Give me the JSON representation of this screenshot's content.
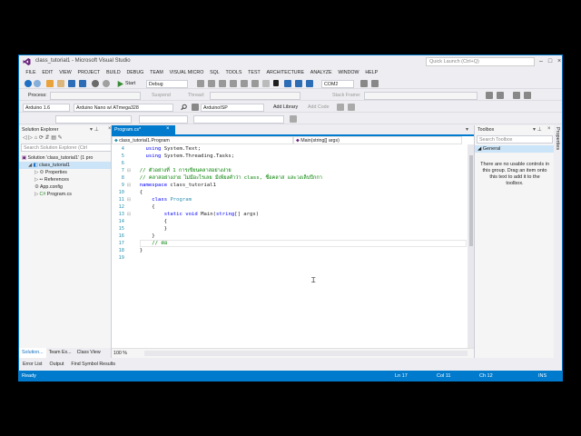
{
  "title": "class_tutorial1 - Microsoft Visual Studio",
  "quick_launch": "Quick Launch (Ctrl+Q)",
  "menu": [
    "FILE",
    "EDIT",
    "VIEW",
    "PROJECT",
    "BUILD",
    "DEBUG",
    "TEAM",
    "VISUAL MICRO",
    "SQL",
    "TOOLS",
    "TEST",
    "ARCHITECTURE",
    "ANALYZE",
    "WINDOW",
    "HELP"
  ],
  "toolbar1": {
    "start": "Start",
    "config": "Debug",
    "port": "COM2"
  },
  "toolbar2": {
    "process": "Process:",
    "suspend": "Suspend",
    "thread": "Thread:",
    "stack": "Stack Frame:"
  },
  "toolbar3": {
    "ide": "Arduino 1.6",
    "board": "Arduino Nano w/ ATmega328",
    "programmer": "ArduinoISP",
    "add_library": "Add Library",
    "add_code": "Add Code"
  },
  "solution_explorer": {
    "title": "Solution Explorer",
    "search": "Search Solution Explorer (Ctrl",
    "items": [
      {
        "label": "Solution 'class_tutorial1' (1 pro",
        "indent": 0
      },
      {
        "label": "class_tutorial1",
        "indent": 1
      },
      {
        "label": "Properties",
        "indent": 2
      },
      {
        "label": "References",
        "indent": 2
      },
      {
        "label": "App.config",
        "indent": 2
      },
      {
        "label": "Program.cs",
        "indent": 2
      }
    ],
    "bottom_tabs": [
      "Solution...",
      "Team Ex...",
      "Class View"
    ]
  },
  "editor": {
    "tab": "Program.cs*",
    "nav_left": "class_tutorial1.Program",
    "nav_right": "Main(string[] args)",
    "zoom": "100 %",
    "lines": [
      {
        "n": "4",
        "t": "    using System.Text;"
      },
      {
        "n": "5",
        "t": "    using System.Threading.Tasks;"
      },
      {
        "n": "6",
        "t": ""
      },
      {
        "n": "7",
        "t": "  // ตัวอย่างที่ 1 การเขียนคลาสอย่างง่าย"
      },
      {
        "n": "8",
        "t": "  // คลาสอย่างง่าย ไม่มีอะไรเลย มีเพียงคำว่า class, ชื่อคลาส และวงเล็บปีกกา"
      },
      {
        "n": "9",
        "t": "  namespace class_tutorial1"
      },
      {
        "n": "10",
        "t": "  {"
      },
      {
        "n": "11",
        "t": "      class Program"
      },
      {
        "n": "12",
        "t": "      {"
      },
      {
        "n": "13",
        "t": "          static void Main(string[] args)"
      },
      {
        "n": "14",
        "t": "          {"
      },
      {
        "n": "15",
        "t": "          }"
      },
      {
        "n": "16",
        "t": "      }"
      },
      {
        "n": "17",
        "t": "      // ต่อ"
      },
      {
        "n": "18",
        "t": "  }"
      },
      {
        "n": "19",
        "t": ""
      }
    ]
  },
  "toolbox": {
    "title": "Toolbox",
    "search": "Search Toolbox",
    "group": "General",
    "message": "There are no usable controls in this group. Drag an item onto this text to add it to the toolbox."
  },
  "properties_tab": "Properties",
  "bottom_tabs": [
    "Error List",
    "Output",
    "Find Symbol Results"
  ],
  "status": {
    "ready": "Ready",
    "ln": "Ln 17",
    "col": "Col 11",
    "ch": "Ch 12",
    "ins": "INS"
  },
  "colors": {
    "accent": "#007acc",
    "keyword": "#0000ff",
    "type": "#2b91af",
    "comment": "#008000"
  }
}
